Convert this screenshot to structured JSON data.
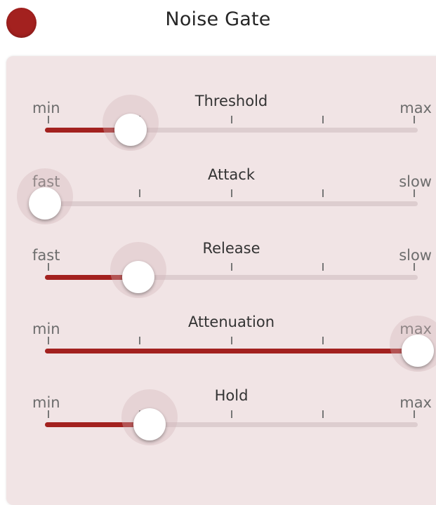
{
  "header": {
    "title": "Noise Gate",
    "power_color": "#a3211f"
  },
  "sliders": [
    {
      "label": "Threshold",
      "min_label": "min",
      "max_label": "max",
      "value": 0.23
    },
    {
      "label": "Attack",
      "min_label": "fast",
      "max_label": "slow",
      "value": 0.0
    },
    {
      "label": "Release",
      "min_label": "fast",
      "max_label": "slow",
      "value": 0.25
    },
    {
      "label": "Attenuation",
      "min_label": "min",
      "max_label": "max",
      "value": 1.0
    },
    {
      "label": "Hold",
      "min_label": "min",
      "max_label": "max",
      "value": 0.28
    }
  ],
  "colors": {
    "accent": "#a3211f",
    "track": "#ddcdcf",
    "panel": "#f1e4e5"
  }
}
